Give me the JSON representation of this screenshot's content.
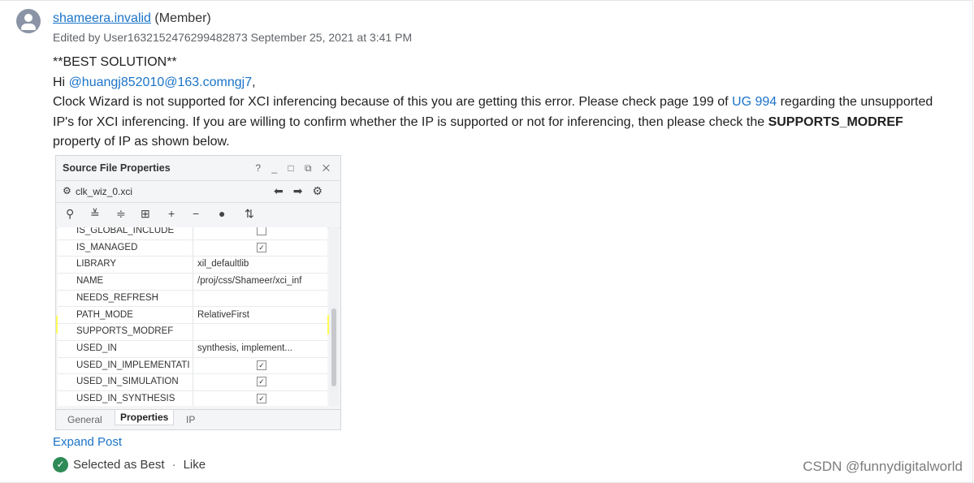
{
  "post": {
    "author": "shameera.invalid",
    "role": "(Member)",
    "edited": "Edited by User1632152476299482873 September 25, 2021 at 3:41 PM",
    "line1": "**BEST SOLUTION**",
    "greeting_prefix": "Hi ",
    "mention": "@huangj852010@163.comngj7",
    "greeting_suffix": ",",
    "para_a": "Clock Wizard is not supported for XCI inferencing because of this you are getting this error. Please check page 199 of ",
    "ug_link": "UG 994",
    "para_b": " regarding the unsupported IP's for XCI inferencing. If  you are willing to confirm whether the IP  is supported or not for inferencing, then please check the ",
    "para_bold": "SUPPORTS_MODREF",
    "para_c": "property of IP as shown below."
  },
  "screenshot": {
    "title": "Source File Properties",
    "window_buttons": "? _ □ ⧉ ✕",
    "file": "clk_wiz_0.xci",
    "rows": [
      {
        "name": "IS_GLOBAL_INCLUDE",
        "value": "",
        "check": "empty"
      },
      {
        "name": "IS_MANAGED",
        "value": "",
        "check": "checked"
      },
      {
        "name": "LIBRARY",
        "value": "xil_defaultlib"
      },
      {
        "name": "NAME",
        "value": "/proj/css/Shameer/xci_inf"
      },
      {
        "name": "NEEDS_REFRESH",
        "value": ""
      },
      {
        "name": "PATH_MODE",
        "value": "RelativeFirst"
      },
      {
        "name": "SUPPORTS_MODREF",
        "value": ""
      },
      {
        "name": "USED_IN",
        "value": "synthesis, implement..."
      },
      {
        "name": "USED_IN_IMPLEMENTATI",
        "value": "",
        "check": "checked"
      },
      {
        "name": "USED_IN_SIMULATION",
        "value": "",
        "check": "checked"
      },
      {
        "name": "USED_IN_SYNTHESIS",
        "value": "",
        "check": "checked"
      }
    ],
    "tabs": [
      "General",
      "Properties",
      "IP"
    ]
  },
  "actions": {
    "expand": "Expand Post",
    "selected": "Selected as Best",
    "separator": "·",
    "like": "Like"
  },
  "watermark": "CSDN @funnydigitalworld",
  "colors": {
    "link": "#1a73c8",
    "best": "#2e8b57",
    "highlight": "#ffff3a"
  }
}
